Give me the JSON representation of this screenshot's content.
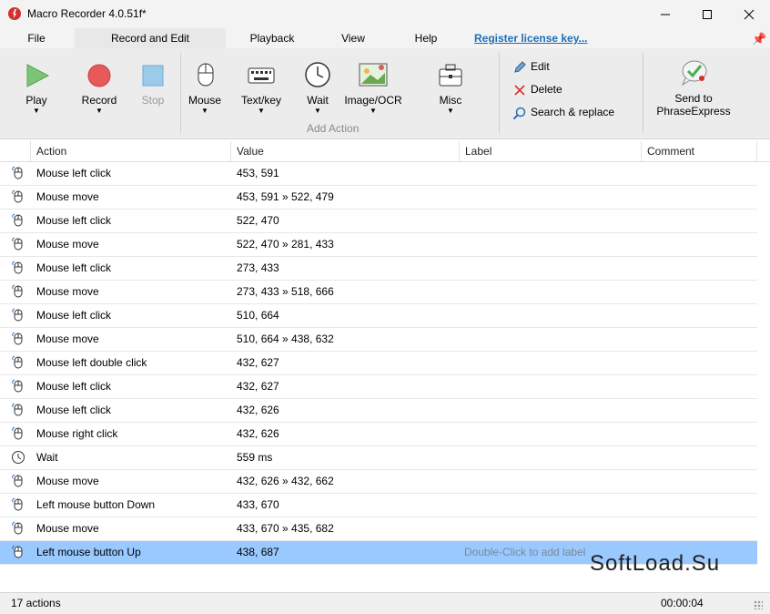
{
  "window": {
    "title": "Macro Recorder 4.0.51f*",
    "minimize_icon": "minimize-icon",
    "maximize_icon": "maximize-icon",
    "close_icon": "close-icon"
  },
  "menu": {
    "file": "File",
    "record_edit": "Record and Edit",
    "playback": "Playback",
    "view": "View",
    "help": "Help",
    "register": "Register license key...",
    "active_tab": "Record and Edit"
  },
  "ribbon": {
    "play": "Play",
    "record": "Record",
    "stop": "Stop",
    "mouse": "Mouse",
    "textkey": "Text/key",
    "wait": "Wait",
    "imageocr": "Image/OCR",
    "add_action": "Add Action",
    "misc": "Misc",
    "edit": "Edit",
    "delete": "Delete",
    "search_replace": "Search & replace",
    "send_to_1": "Send to",
    "send_to_2": "PhraseExpress"
  },
  "grid": {
    "columns": {
      "action": "Action",
      "value": "Value",
      "label": "Label",
      "comment": "Comment"
    },
    "rows": [
      {
        "icon": "mouse-icon",
        "action": "Mouse left click",
        "value": "453, 591",
        "label": ""
      },
      {
        "icon": "mouse-icon",
        "action": "Mouse move",
        "value": "453, 591 » 522, 479",
        "label": ""
      },
      {
        "icon": "mouse-icon",
        "action": "Mouse left click",
        "value": "522, 470",
        "label": ""
      },
      {
        "icon": "mouse-icon",
        "action": "Mouse move",
        "value": "522, 470 » 281, 433",
        "label": ""
      },
      {
        "icon": "mouse-icon",
        "action": "Mouse left click",
        "value": "273, 433",
        "label": ""
      },
      {
        "icon": "mouse-icon",
        "action": "Mouse move",
        "value": "273, 433 » 518, 666",
        "label": ""
      },
      {
        "icon": "mouse-icon",
        "action": "Mouse left click",
        "value": "510, 664",
        "label": ""
      },
      {
        "icon": "mouse-icon",
        "action": "Mouse move",
        "value": "510, 664 » 438, 632",
        "label": ""
      },
      {
        "icon": "mouse-icon",
        "action": "Mouse left double click",
        "value": "432, 627",
        "label": ""
      },
      {
        "icon": "mouse-icon",
        "action": "Mouse left click",
        "value": "432, 627",
        "label": ""
      },
      {
        "icon": "mouse-icon",
        "action": "Mouse left click",
        "value": "432, 626",
        "label": ""
      },
      {
        "icon": "mouse-icon",
        "action": "Mouse right click",
        "value": "432, 626",
        "label": ""
      },
      {
        "icon": "clock-icon",
        "action": "Wait",
        "value": "559 ms",
        "label": ""
      },
      {
        "icon": "mouse-icon",
        "action": "Mouse move",
        "value": "432, 626 » 432, 662",
        "label": ""
      },
      {
        "icon": "mouse-icon",
        "action": "Left mouse button Down",
        "value": "433, 670",
        "label": ""
      },
      {
        "icon": "mouse-icon",
        "action": "Mouse move",
        "value": "433, 670 » 435, 682",
        "label": ""
      },
      {
        "icon": "mouse-icon",
        "action": "Left mouse button Up",
        "value": "438, 687",
        "label": "Double-Click to add label",
        "selected": true
      }
    ]
  },
  "status": {
    "count": "17 actions",
    "time": "00:00:04"
  },
  "watermark": "SoftLoad.Su",
  "colors": {
    "selection": "#99c9ff",
    "link": "#1e6fb8",
    "record_red": "#e85a5a",
    "play_green": "#7cc576"
  }
}
